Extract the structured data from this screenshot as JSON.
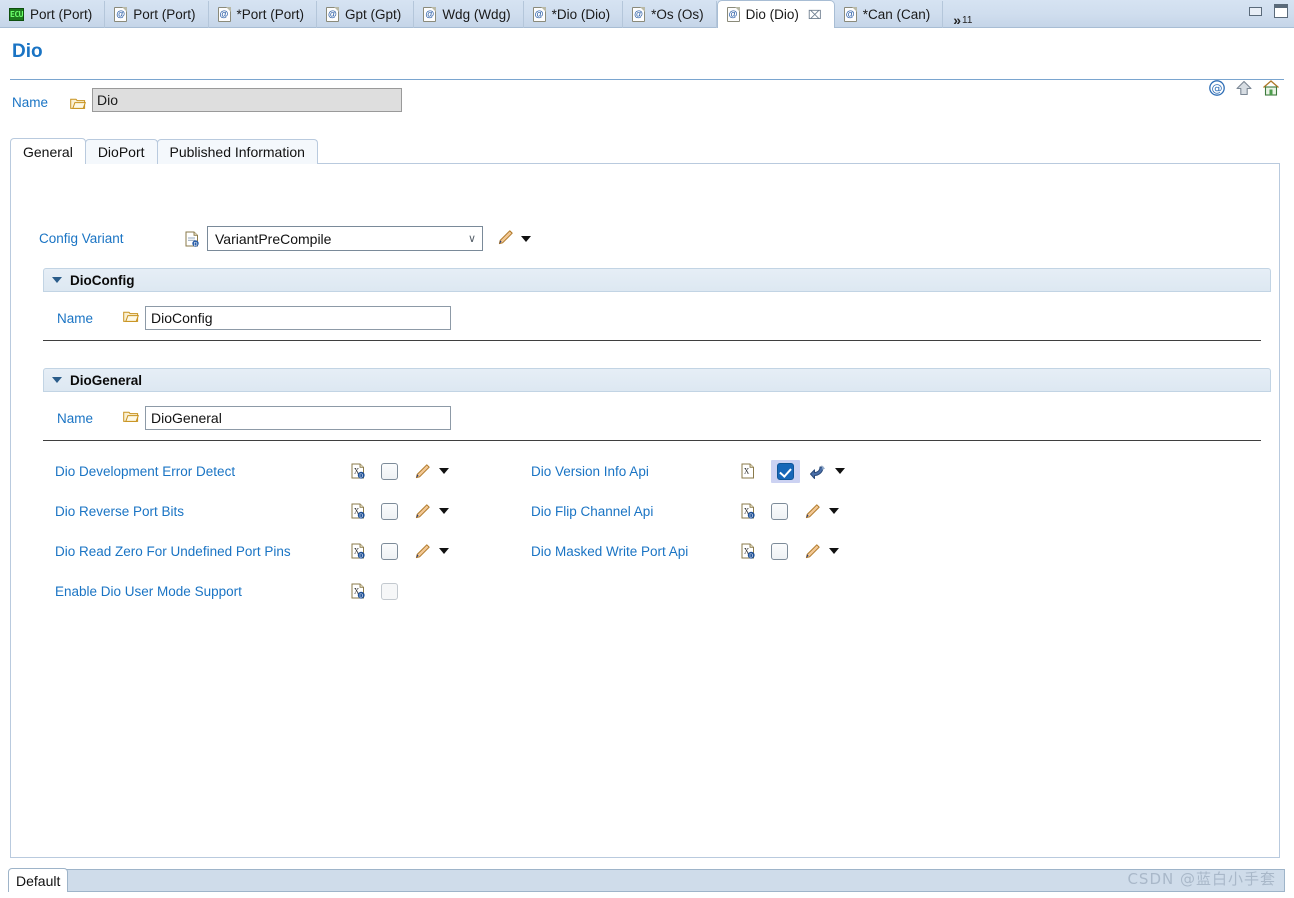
{
  "window": {
    "minimize_label": "Minimize",
    "maximize_label": "Maximize"
  },
  "editor_tabs": {
    "overflow_chevron": "»",
    "overflow_count": "11",
    "items": [
      {
        "label": "Port (Port)",
        "icon": "ecu-icon",
        "active": false,
        "dirty": false
      },
      {
        "label": "Port (Port)",
        "icon": "module-doc-icon",
        "active": false,
        "dirty": false
      },
      {
        "label": "*Port (Port)",
        "icon": "module-doc-icon",
        "active": false,
        "dirty": true
      },
      {
        "label": "Gpt (Gpt)",
        "icon": "module-doc-icon",
        "active": false,
        "dirty": false
      },
      {
        "label": "Wdg (Wdg)",
        "icon": "module-doc-icon",
        "active": false,
        "dirty": false
      },
      {
        "label": "*Dio (Dio)",
        "icon": "module-doc-icon",
        "active": false,
        "dirty": true
      },
      {
        "label": "*Os (Os)",
        "icon": "module-doc-icon",
        "active": false,
        "dirty": true
      },
      {
        "label": "Dio (Dio)",
        "icon": "module-doc-icon",
        "active": true,
        "dirty": false,
        "close_glyph": "⌧"
      },
      {
        "label": "*Can (Can)",
        "icon": "module-doc-icon",
        "active": false,
        "dirty": true
      }
    ]
  },
  "header": {
    "title": "Dio",
    "icons": [
      {
        "name": "link-at-icon"
      },
      {
        "name": "up-arrow-icon"
      },
      {
        "name": "home-icon"
      }
    ]
  },
  "name_row": {
    "label": "Name",
    "value": "Dio",
    "folder_icon": "open-folder-icon"
  },
  "inner_tabs": [
    {
      "label": "General",
      "active": true
    },
    {
      "label": "DioPort",
      "active": false
    },
    {
      "label": "Published Information",
      "active": false
    }
  ],
  "config_variant": {
    "label": "Config Variant",
    "value": "VariantPreCompile",
    "chevron": "∨",
    "options": [
      "VariantPreCompile"
    ],
    "edit_icon": "pencil-icon",
    "menu_icon": "caret-down-icon"
  },
  "sections": [
    {
      "title": "DioConfig",
      "collapse_icon": "triangle-down-icon",
      "name_label": "Name",
      "name_value": "DioConfig",
      "folder_icon": "open-folder-icon"
    },
    {
      "title": "DioGeneral",
      "collapse_icon": "triangle-down-icon",
      "name_label": "Name",
      "name_value": "DioGeneral",
      "folder_icon": "open-folder-icon"
    }
  ],
  "parameters": {
    "left_column": [
      {
        "label": "Dio Development Error Detect",
        "param_icon": "xdm-param-icon",
        "checked": false,
        "enabled": true,
        "highlighted": false,
        "action_icon": "pencil-icon",
        "menu_icon": "caret-down-icon"
      },
      {
        "label": "Dio Reverse Port Bits",
        "param_icon": "xdm-param-icon",
        "checked": false,
        "enabled": true,
        "highlighted": false,
        "action_icon": "pencil-icon",
        "menu_icon": "caret-down-icon"
      },
      {
        "label": "Dio Read Zero For Undefined Port Pins",
        "param_icon": "xdm-param-icon",
        "checked": false,
        "enabled": true,
        "highlighted": false,
        "action_icon": "pencil-icon",
        "menu_icon": "caret-down-icon"
      },
      {
        "label": "Enable Dio User Mode Support",
        "param_icon": "xdm-param-icon",
        "checked": false,
        "enabled": false,
        "highlighted": false,
        "action_icon": "",
        "menu_icon": ""
      }
    ],
    "right_column": [
      {
        "label": "Dio Version Info Api",
        "param_icon": "xdm-param-modified-icon",
        "checked": true,
        "enabled": true,
        "highlighted": true,
        "action_icon": "revert-arrow-icon",
        "menu_icon": "caret-down-icon"
      },
      {
        "label": "Dio Flip Channel Api",
        "param_icon": "xdm-param-icon",
        "checked": false,
        "enabled": true,
        "highlighted": false,
        "action_icon": "pencil-icon",
        "menu_icon": "caret-down-icon"
      },
      {
        "label": "Dio Masked Write Port Api",
        "param_icon": "xdm-param-icon",
        "checked": false,
        "enabled": true,
        "highlighted": false,
        "action_icon": "pencil-icon",
        "menu_icon": "caret-down-icon"
      }
    ]
  },
  "bottom": {
    "tab_label": "Default",
    "watermark": "CSDN @蓝白小手套"
  },
  "colors": {
    "accent_link": "#1a74c4",
    "title": "#1a74c4",
    "tabbar_bg": "#cfddee",
    "section_band": "#e1ebf4",
    "checkbox_checked": "#1767b8",
    "highlight_bg": "#ccd2f2"
  }
}
